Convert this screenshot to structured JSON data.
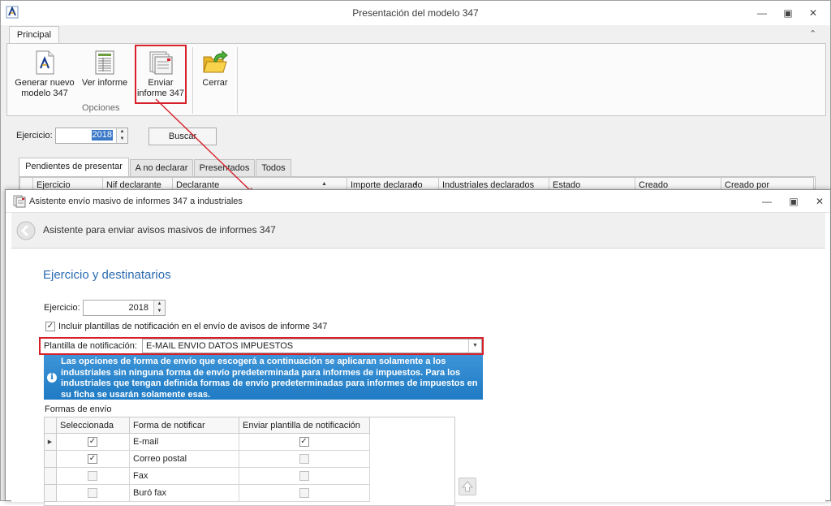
{
  "main_window": {
    "title": "Presentación del modelo 347",
    "ribbon": {
      "tab": "Principal",
      "buttons": {
        "generar": "Generar nuevo modelo 347",
        "ver": "Ver informe",
        "enviar": "Enviar informe 347",
        "cerrar": "Cerrar"
      },
      "group_label": "Opciones"
    },
    "filter": {
      "ejercicio_label": "Ejercicio:",
      "ejercicio_value": "2018",
      "buscar": "Buscar"
    },
    "tabs": [
      "Pendientes de presentar",
      "A no declarar",
      "Presentados",
      "Todos"
    ],
    "grid_columns": [
      "Ejercicio",
      "Nif declarante",
      "Declarante",
      "Importe declarado",
      "Industriales declarados",
      "Estado",
      "Creado",
      "Creado por"
    ]
  },
  "wizard": {
    "title": "Asistente envío masivo de informes 347 a industriales",
    "header": "Asistente para enviar avisos masivos de informes 347",
    "section_title": "Ejercicio y destinatarios",
    "ejercicio_label": "Ejercicio:",
    "ejercicio_value": "2018",
    "include_templates_label": "Incluir plantillas de notificación en el envío de avisos de informe 347",
    "template_label": "Plantilla de notificación:",
    "template_value": "E-MAIL ENVIO DATOS IMPUESTOS",
    "info_text": "Las opciones de forma de envío que escogerá a continuación se aplicaran solamente a los industriales sin ninguna forma de envío predeterminada para informes de impuestos. Para los industriales que tengan definida formas de envío predeterminadas para informes de impuestos en su ficha se usarán solamente esas.",
    "formas_label": "Formas de envío",
    "formas_columns": [
      "Seleccionada",
      "Forma de notificar",
      "Enviar plantilla de notificación"
    ],
    "formas_rows": [
      {
        "forma": "E-mail",
        "seleccionada": true,
        "enviar_plantilla": true
      },
      {
        "forma": "Correo postal",
        "seleccionada": true,
        "enviar_plantilla": false
      },
      {
        "forma": "Fax",
        "seleccionada": false,
        "enviar_plantilla": false
      },
      {
        "forma": "Buró fax",
        "seleccionada": false,
        "enviar_plantilla": false
      }
    ]
  },
  "glyphs": {
    "check": "✓",
    "minimize": "—",
    "restore": "▣",
    "close": "✕",
    "collapse": "⌃",
    "info": "i",
    "row_indicator": "▶",
    "up": "▲",
    "down": "▼"
  },
  "colors": {
    "highlight_red": "#d6202a",
    "info_blue": "#1f7bc4",
    "section_blue": "#2a6ab0",
    "spin_selection": "#3a78c8"
  }
}
